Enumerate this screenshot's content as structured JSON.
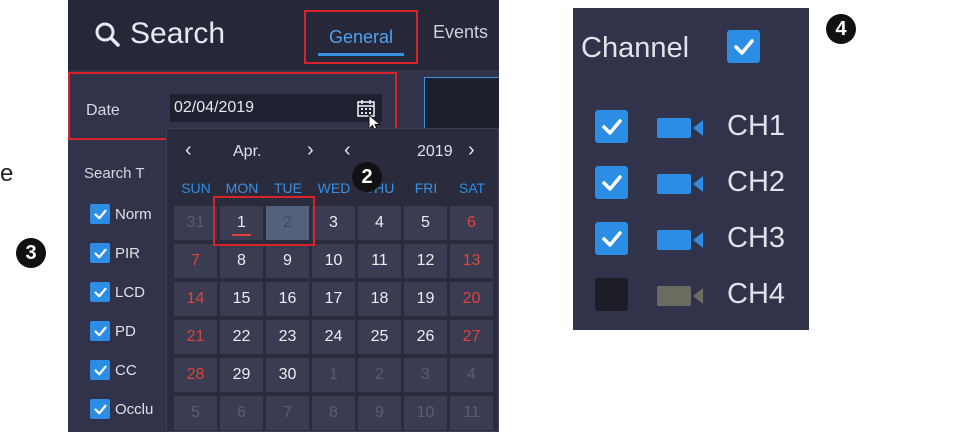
{
  "search_panel": {
    "title": "Search",
    "tabs": [
      {
        "label": "General",
        "active": true
      },
      {
        "label": "Events",
        "active": false
      }
    ],
    "date": {
      "label": "Date",
      "value": "02/04/2019"
    },
    "search_type_label": "Search T",
    "events": [
      {
        "label": "Norm",
        "checked": true
      },
      {
        "label": "PIR",
        "checked": true
      },
      {
        "label": "LCD",
        "checked": true
      },
      {
        "label": "PD",
        "checked": true
      },
      {
        "label": "CC",
        "checked": true
      },
      {
        "label": "Occlu",
        "checked": true
      }
    ]
  },
  "calendar": {
    "month": "Apr.",
    "year": "2019",
    "weekdays": [
      "SUN",
      "MON",
      "TUE",
      "WED",
      "THU",
      "FRI",
      "SAT"
    ],
    "weeks": [
      [
        "31",
        "1",
        "2",
        "3",
        "4",
        "5",
        "6"
      ],
      [
        "7",
        "8",
        "9",
        "10",
        "11",
        "12",
        "13"
      ],
      [
        "14",
        "15",
        "16",
        "17",
        "18",
        "19",
        "20"
      ],
      [
        "21",
        "22",
        "23",
        "24",
        "25",
        "26",
        "27"
      ],
      [
        "28",
        "29",
        "30",
        "1",
        "2",
        "3",
        "4"
      ],
      [
        "5",
        "6",
        "7",
        "8",
        "9",
        "10",
        "11"
      ]
    ],
    "today": "1",
    "selected": "2"
  },
  "callouts": {
    "c2": "2",
    "c3": "3",
    "c4": "4"
  },
  "peek_text": "e",
  "channel_panel": {
    "title": "Channel",
    "all_checked": true,
    "channels": [
      {
        "label": "CH1",
        "checked": true
      },
      {
        "label": "CH2",
        "checked": true
      },
      {
        "label": "CH3",
        "checked": true
      },
      {
        "label": "CH4",
        "checked": false
      }
    ]
  },
  "colors": {
    "accent": "#2b8de3",
    "highlight_border": "#d9222a",
    "weekend": "#e0423c",
    "panel_bg": "#30334a",
    "camera_active": "#2b8de3",
    "camera_inactive": "#6b6b5f"
  },
  "icons": {
    "search": "search-icon",
    "calendar": "calendar-icon",
    "checkbox": "check-icon",
    "camera": "camera-icon",
    "arrow": "chevron-icon"
  }
}
